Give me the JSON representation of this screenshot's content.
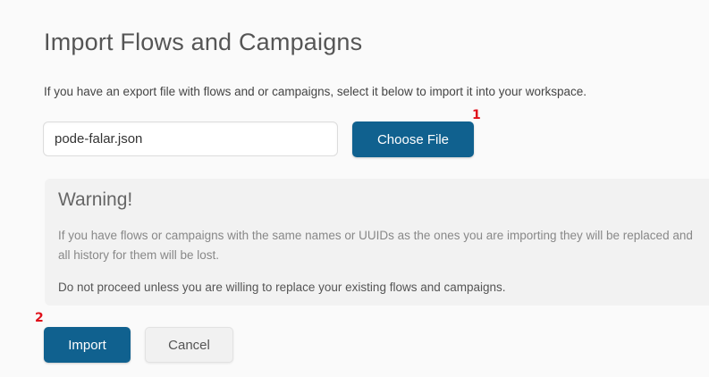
{
  "page": {
    "title": "Import Flows and Campaigns",
    "intro": "If you have an export file with flows and or campaigns, select it below to import it into your workspace."
  },
  "file_picker": {
    "filename": "pode-falar.json",
    "choose_label": "Choose File"
  },
  "markers": {
    "one": "1",
    "two": "2"
  },
  "warning": {
    "heading": "Warning!",
    "text1": "If you have flows or campaigns with the same names or UUIDs as the ones you are importing they will be replaced and all history for them will be lost.",
    "text2": "Do not proceed unless you are willing to replace your existing flows and campaigns."
  },
  "actions": {
    "import_label": "Import",
    "cancel_label": "Cancel"
  },
  "colors": {
    "primary": "#10618f",
    "marker": "#e0101a",
    "warning_bg": "#f2f2f2"
  }
}
